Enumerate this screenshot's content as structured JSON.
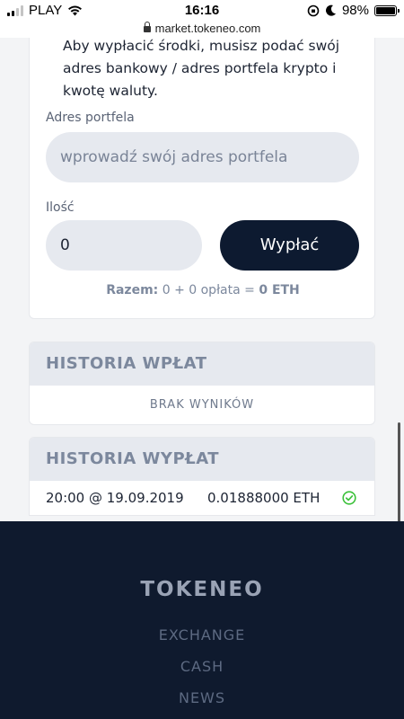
{
  "status_bar": {
    "carrier": "PLAY",
    "time": "16:16",
    "battery": "98%"
  },
  "browser": {
    "url": "market.tokeneo.com"
  },
  "withdraw": {
    "intro_text": "Aby wypłacić środki, musisz podać swój adres bankowy / adres portfela krypto i kwotę waluty.",
    "wallet_label": "Adres portfela",
    "wallet_placeholder": "wprowadź swój adres portfela",
    "amount_label": "Ilość",
    "amount_value": "0",
    "withdraw_button": "Wypłać",
    "total_label": "Razem:",
    "total_expression": "0 + 0 opłata =",
    "total_result": "0 ETH"
  },
  "deposit_history": {
    "title": "HISTORIA WPŁAT",
    "empty_text": "BRAK WYNIKÓW"
  },
  "payout_history": {
    "title": "HISTORIA WYPŁAT",
    "rows": [
      {
        "datetime": "20:00 @ 19.09.2019",
        "amount": "0.01888000 ETH",
        "status_icon": "check-circle-icon"
      }
    ]
  },
  "footer": {
    "brand": "TOKENEO",
    "links": [
      "EXCHANGE",
      "CASH",
      "NEWS"
    ]
  },
  "colors": {
    "accent_dark": "#0d1a30",
    "footer_bg": "#0f1a2e",
    "success": "#3cc13b"
  }
}
